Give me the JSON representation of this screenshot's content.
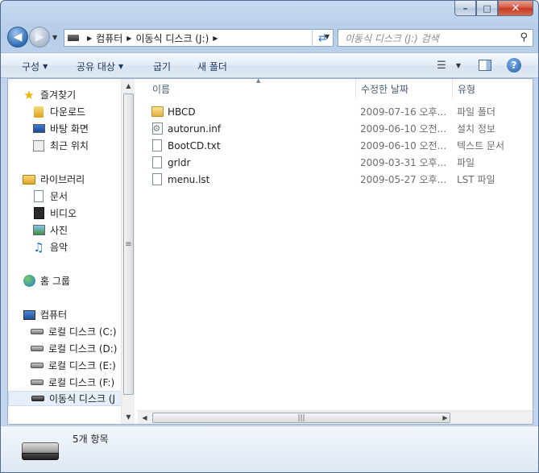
{
  "window": {
    "caption_buttons": {
      "minimize": "–",
      "maximize": "□",
      "close": "✕"
    }
  },
  "address_bar": {
    "crumbs": [
      "컴퓨터",
      "이동식 디스크 (J:)"
    ],
    "search_placeholder": "이동식 디스크 (J:) 검색"
  },
  "toolbar": {
    "organize": "구성",
    "share": "공유 대상",
    "burn": "굽기",
    "new_folder": "새 폴더"
  },
  "sidebar": {
    "favorites": {
      "label": "즐겨찾기",
      "items": [
        "다운로드",
        "바탕 화면",
        "최근 위치"
      ]
    },
    "libraries": {
      "label": "라이브러리",
      "items": [
        "문서",
        "비디오",
        "사진",
        "음악"
      ]
    },
    "homegroup": {
      "label": "홈 그룹"
    },
    "computer": {
      "label": "컴퓨터",
      "items": [
        "로컬 디스크 (C:)",
        "로컬 디스크 (D:)",
        "로컬 디스크 (E:)",
        "로컬 디스크 (F:)",
        "이동식 디스크 (J"
      ]
    }
  },
  "columns": {
    "name": "이름",
    "date": "수정한 날짜",
    "type": "유형"
  },
  "files": [
    {
      "name": "HBCD",
      "date": "2009-07-16 오후...",
      "type": "파일 폴더",
      "icon": "folder-icon"
    },
    {
      "name": "autorun.inf",
      "date": "2009-06-10 오전...",
      "type": "설치 정보",
      "icon": "setup-file-icon"
    },
    {
      "name": "BootCD.txt",
      "date": "2009-06-10 오전...",
      "type": "텍스트 문서",
      "icon": "text-file-icon"
    },
    {
      "name": "grldr",
      "date": "2009-03-31 오후...",
      "type": "파일",
      "icon": "file-icon"
    },
    {
      "name": "menu.lst",
      "date": "2009-05-27 오후...",
      "type": "LST 파일",
      "icon": "file-icon"
    }
  ],
  "details": {
    "item_count": "5개 항목"
  }
}
